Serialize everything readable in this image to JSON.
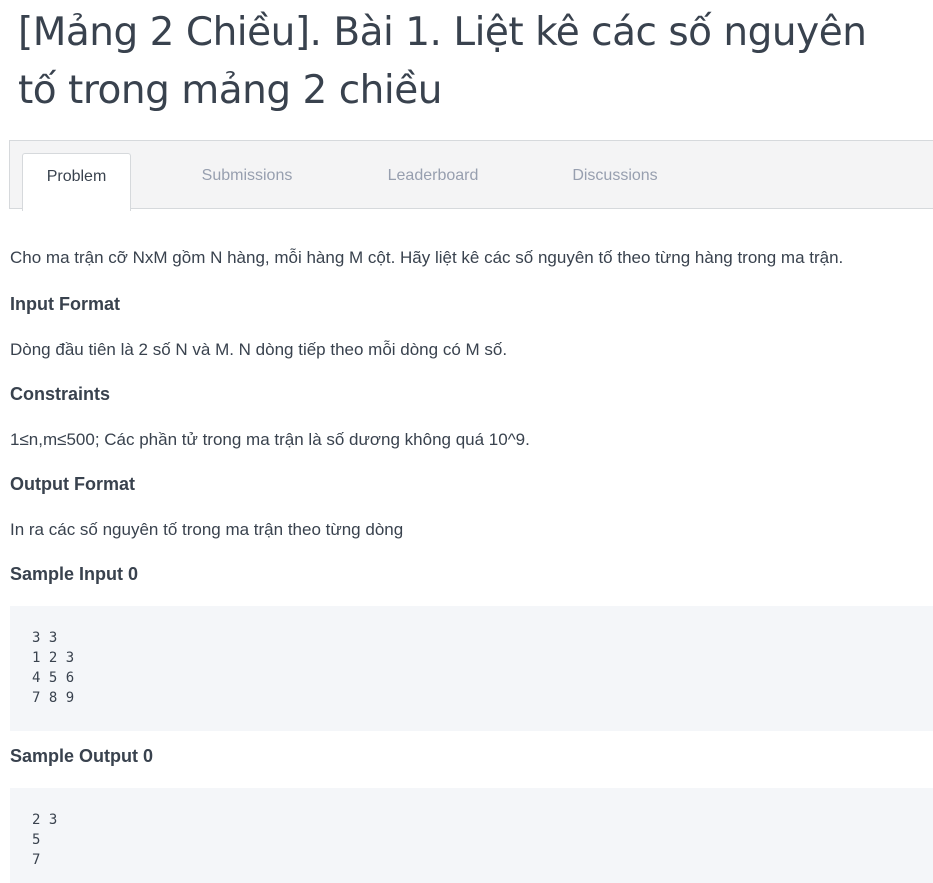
{
  "title": "[Mảng 2 Chiều]. Bài 1. Liệt kê các số nguyên tố trong mảng 2 chiều",
  "tabs": [
    {
      "label": "Problem",
      "active": true
    },
    {
      "label": "Submissions",
      "active": false
    },
    {
      "label": "Leaderboard",
      "active": false
    },
    {
      "label": "Discussions",
      "active": false
    }
  ],
  "problem": {
    "statement": "Cho ma trận cỡ NxM gồm N hàng, mỗi hàng M cột. Hãy liệt kê các số nguyên tố theo từng hàng trong ma trận.",
    "input_format_heading": "Input Format",
    "input_format": "Dòng đầu tiên là 2 số N và M. N dòng tiếp theo mỗi dòng có M số.",
    "constraints_heading": "Constraints",
    "constraints": "1≤n,m≤500; Các phần tử trong ma trận là số dương không quá 10^9.",
    "output_format_heading": "Output Format",
    "output_format": "In ra các số nguyên tố trong ma trận theo từng dòng",
    "sample_input_heading": "Sample Input 0",
    "sample_input": [
      "3 3",
      "1 2 3",
      "4 5 6",
      "7 8 9"
    ],
    "sample_output_heading": "Sample Output 0",
    "sample_output": [
      "2 3",
      "5",
      "7"
    ]
  }
}
